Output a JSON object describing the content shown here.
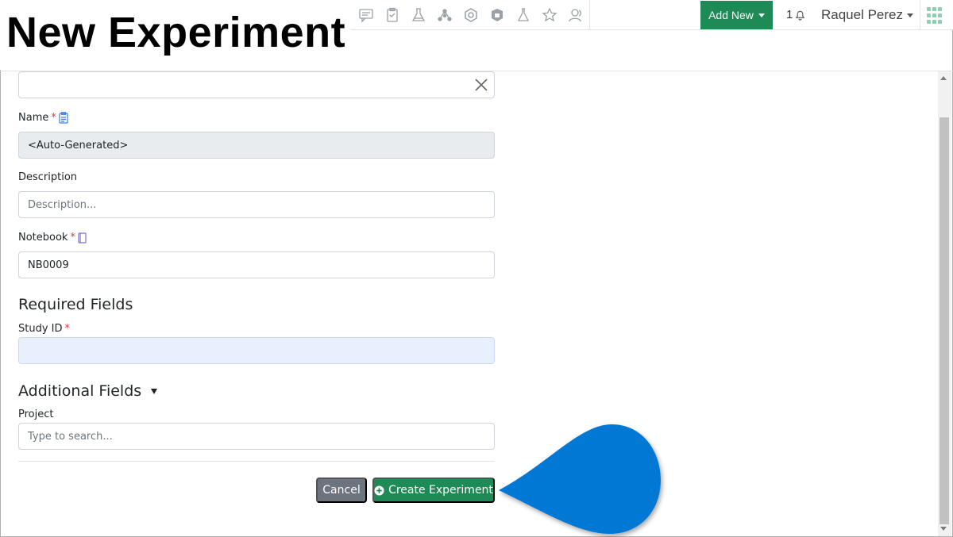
{
  "page": {
    "title": "New Experiment"
  },
  "header": {
    "add_new_label": "Add New",
    "notification_count": "1",
    "user_name": "Raquel Perez",
    "nav_icons": [
      "comment-icon",
      "clipboard-icon",
      "lab-icon",
      "molecule-icon",
      "hexagon-icon",
      "shield-icon",
      "flask-icon",
      "star-icon",
      "people-icon"
    ]
  },
  "form": {
    "name": {
      "label": "Name",
      "required": "*",
      "value": "<Auto-Generated>"
    },
    "description": {
      "label": "Description",
      "placeholder": "Description..."
    },
    "notebook": {
      "label": "Notebook",
      "required": "*",
      "value": "NB0009"
    },
    "required_section": {
      "title": "Required Fields",
      "study_id_label": "Study ID",
      "required": "*",
      "study_id_value": ""
    },
    "additional_section": {
      "title": "Additional Fields",
      "project_label": "Project",
      "project_placeholder": "Type to search..."
    },
    "cancel_label": "Cancel",
    "create_label": "Create Experiment"
  },
  "colors": {
    "accent_green": "#1e8a55",
    "cancel_gray": "#6c757d",
    "required_red": "#dc3545",
    "highlight_field": "#e8f0fe",
    "disabled_field": "#e9ecef",
    "pointer_blue": "#0078d4"
  }
}
